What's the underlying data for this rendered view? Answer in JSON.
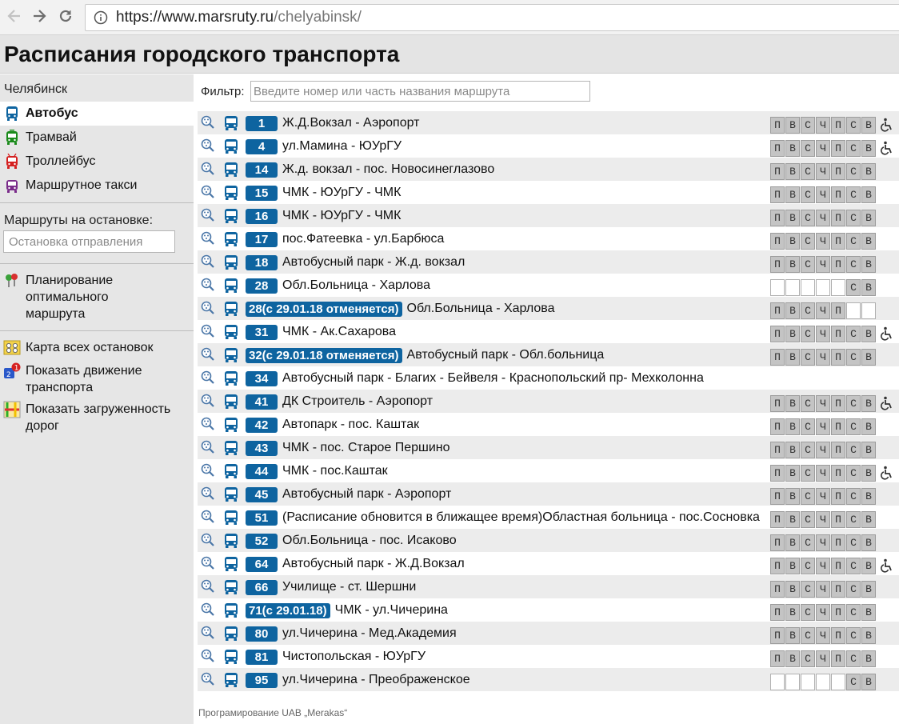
{
  "browser": {
    "url_host": "https://www.marsruty.ru",
    "url_path": "/chelyabinsk/"
  },
  "header": {
    "title": "Расписания городского транспорта"
  },
  "sidebar": {
    "city": "Челябинск",
    "transport_types": [
      {
        "label": "Автобус",
        "icon": "bus-icon",
        "color": "#0e64a0",
        "active": true
      },
      {
        "label": "Трамвай",
        "icon": "tram-icon",
        "color": "#1a8a1a",
        "active": false
      },
      {
        "label": "Троллейбус",
        "icon": "trolleybus-icon",
        "color": "#d42020",
        "active": false
      },
      {
        "label": "Маршрутное такси",
        "icon": "minibus-icon",
        "color": "#7a2b8a",
        "active": false
      }
    ],
    "stops_label": "Маршруты на остановке:",
    "stops_placeholder": "Остановка отправления",
    "planning_label": "Планирование оптимального маршрута",
    "map_label": "Карта всех остановок",
    "movement_label": "Показать движение транспорта",
    "traffic_label": "Показать загруженность дорог"
  },
  "filter": {
    "label": "Фильтр:",
    "placeholder": "Введите номер или часть названия маршрута"
  },
  "day_letters": [
    "П",
    "В",
    "С",
    "Ч",
    "П",
    "С",
    "В"
  ],
  "routes": [
    {
      "num": "1",
      "name": "Ж.Д.Вокзал - Аэропорт",
      "days": [
        1,
        1,
        1,
        1,
        1,
        1,
        1
      ],
      "wheelchair": true
    },
    {
      "num": "4",
      "name": "ул.Мамина - ЮУрГУ",
      "days": [
        1,
        1,
        1,
        1,
        1,
        1,
        1
      ],
      "wheelchair": true
    },
    {
      "num": "14",
      "name": "Ж.д. вокзал - пос. Новосинеглазово",
      "days": [
        1,
        1,
        1,
        1,
        1,
        1,
        1
      ],
      "wheelchair": false
    },
    {
      "num": "15",
      "name": "ЧМК - ЮУрГУ - ЧМК",
      "days": [
        1,
        1,
        1,
        1,
        1,
        1,
        1
      ],
      "wheelchair": false
    },
    {
      "num": "16",
      "name": "ЧМК - ЮУрГУ - ЧМК",
      "days": [
        1,
        1,
        1,
        1,
        1,
        1,
        1
      ],
      "wheelchair": false
    },
    {
      "num": "17",
      "name": "пос.Фатеевка - ул.Барбюса",
      "days": [
        1,
        1,
        1,
        1,
        1,
        1,
        1
      ],
      "wheelchair": false
    },
    {
      "num": "18",
      "name": "Автобусный парк - Ж.д. вокзал",
      "days": [
        1,
        1,
        1,
        1,
        1,
        1,
        1
      ],
      "wheelchair": false
    },
    {
      "num": "28",
      "name": "Обл.Больница - Харлова",
      "days": [
        0,
        0,
        0,
        0,
        0,
        1,
        1
      ],
      "wheelchair": false
    },
    {
      "num": "28(с 29.01.18 отменяется)",
      "name": "Обл.Больница - Харлова",
      "days": [
        1,
        1,
        1,
        1,
        1,
        0,
        0
      ],
      "wheelchair": false
    },
    {
      "num": "31",
      "name": "ЧМК - Ак.Сахарова",
      "days": [
        1,
        1,
        1,
        1,
        1,
        1,
        1
      ],
      "wheelchair": true
    },
    {
      "num": "32(с 29.01.18 отменяется)",
      "name": "Автобусный парк - Обл.больница",
      "days": [
        1,
        1,
        1,
        1,
        1,
        1,
        1
      ],
      "wheelchair": false
    },
    {
      "num": "34",
      "name": "Автобусный парк - Благих - Бейвеля - Краснопольский пр- Мехколонна",
      "days": [],
      "wheelchair": false
    },
    {
      "num": "41",
      "name": "ДК Строитель - Аэропорт",
      "days": [
        1,
        1,
        1,
        1,
        1,
        1,
        1
      ],
      "wheelchair": true
    },
    {
      "num": "42",
      "name": "Автопарк - пос. Каштак",
      "days": [
        1,
        1,
        1,
        1,
        1,
        1,
        1
      ],
      "wheelchair": false
    },
    {
      "num": "43",
      "name": "ЧМК - пос. Старое Першино",
      "days": [
        1,
        1,
        1,
        1,
        1,
        1,
        1
      ],
      "wheelchair": false
    },
    {
      "num": "44",
      "name": "ЧМК - пос.Каштак",
      "days": [
        1,
        1,
        1,
        1,
        1,
        1,
        1
      ],
      "wheelchair": true
    },
    {
      "num": "45",
      "name": "Автобусный парк - Аэропорт",
      "days": [
        1,
        1,
        1,
        1,
        1,
        1,
        1
      ],
      "wheelchair": false
    },
    {
      "num": "51",
      "name": "(Расписание обновится в ближащее время)Областная больница - пос.Сосновка",
      "days": [
        1,
        1,
        1,
        1,
        1,
        1,
        1
      ],
      "wheelchair": false
    },
    {
      "num": "52",
      "name": "Обл.Больница - пос. Исаково",
      "days": [
        1,
        1,
        1,
        1,
        1,
        1,
        1
      ],
      "wheelchair": false
    },
    {
      "num": "64",
      "name": "Автобусный парк - Ж.Д.Вокзал",
      "days": [
        1,
        1,
        1,
        1,
        1,
        1,
        1
      ],
      "wheelchair": true
    },
    {
      "num": "66",
      "name": "Училище - ст. Шершни",
      "days": [
        1,
        1,
        1,
        1,
        1,
        1,
        1
      ],
      "wheelchair": false
    },
    {
      "num": "71(с 29.01.18)",
      "name": "ЧМК - ул.Чичерина",
      "days": [
        1,
        1,
        1,
        1,
        1,
        1,
        1
      ],
      "wheelchair": false
    },
    {
      "num": "80",
      "name": "ул.Чичерина - Мед.Академия",
      "days": [
        1,
        1,
        1,
        1,
        1,
        1,
        1
      ],
      "wheelchair": false
    },
    {
      "num": "81",
      "name": "Чистопольская - ЮУрГУ",
      "days": [
        1,
        1,
        1,
        1,
        1,
        1,
        1
      ],
      "wheelchair": false
    },
    {
      "num": "95",
      "name": "ул.Чичерина - Преображенское",
      "days": [
        0,
        0,
        0,
        0,
        0,
        1,
        1
      ],
      "wheelchair": false
    }
  ],
  "footer": "Програмирование UAB „Merakas“",
  "colors": {
    "route_badge": "#0e64a0",
    "header_bg": "#e4e4e4",
    "sidebar_bg": "#e6e6e6",
    "row_alt": "#ececec",
    "day_on": "#c4c4c4"
  }
}
